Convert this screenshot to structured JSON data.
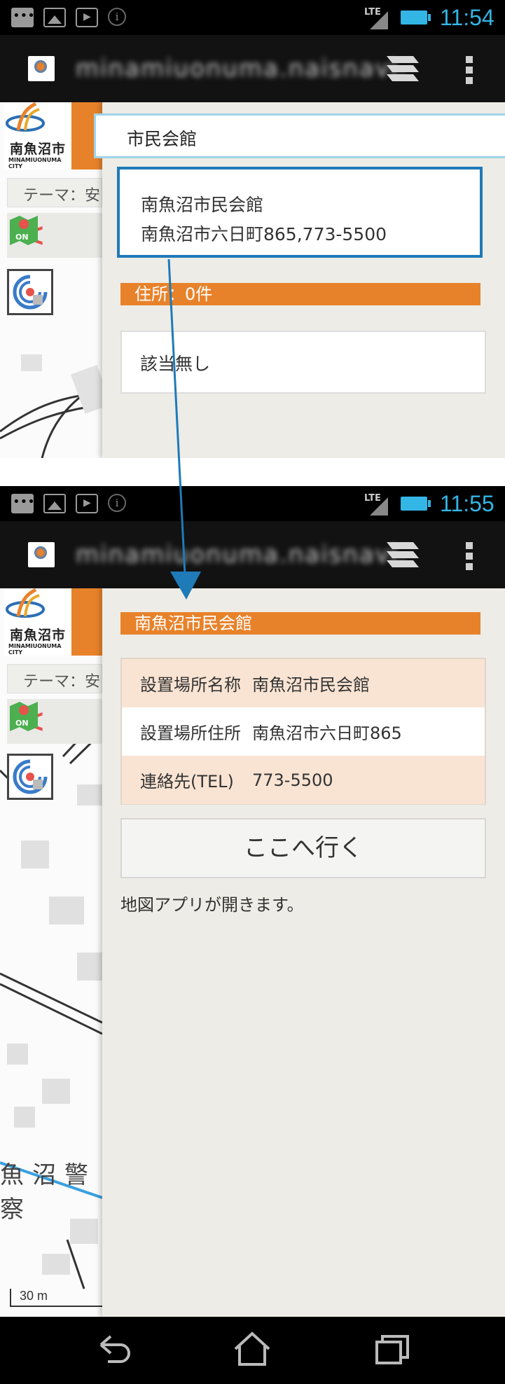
{
  "top": {
    "status": {
      "time": "11:54",
      "network": "LTE"
    },
    "url": "minamiuonuma.naisnavi.",
    "search": {
      "value": "市民会館"
    },
    "result": {
      "name": "南魚沼市民会館",
      "detail": "南魚沼市六日町865,773-5500"
    },
    "address_header": "住所：0件",
    "no_match": "該当無し"
  },
  "bottom": {
    "status": {
      "time": "11:55",
      "network": "LTE"
    },
    "url": "minamiuonuma.naisnavi.",
    "title": "南魚沼市民会館",
    "rows": [
      {
        "key": "設置場所名称",
        "value": "南魚沼市民会館"
      },
      {
        "key": "設置場所住所",
        "value": "南魚沼市六日町865"
      },
      {
        "key": "連絡先(TEL)",
        "value": "773-5500"
      }
    ],
    "go_button": "ここへ行く",
    "note": "地図アプリが開きます。",
    "map_label": "魚沼警察",
    "scale": "30 m"
  },
  "map": {
    "logo_text": "南魚沼市",
    "logo_sub": "MINAMIUONUMA CITY",
    "theme_label": "テーマ：安"
  },
  "colors": {
    "accent_orange": "#e8822a",
    "accent_blue": "#1f7ab8",
    "status_blue": "#33b5e5",
    "panel_bg": "#edece6"
  }
}
